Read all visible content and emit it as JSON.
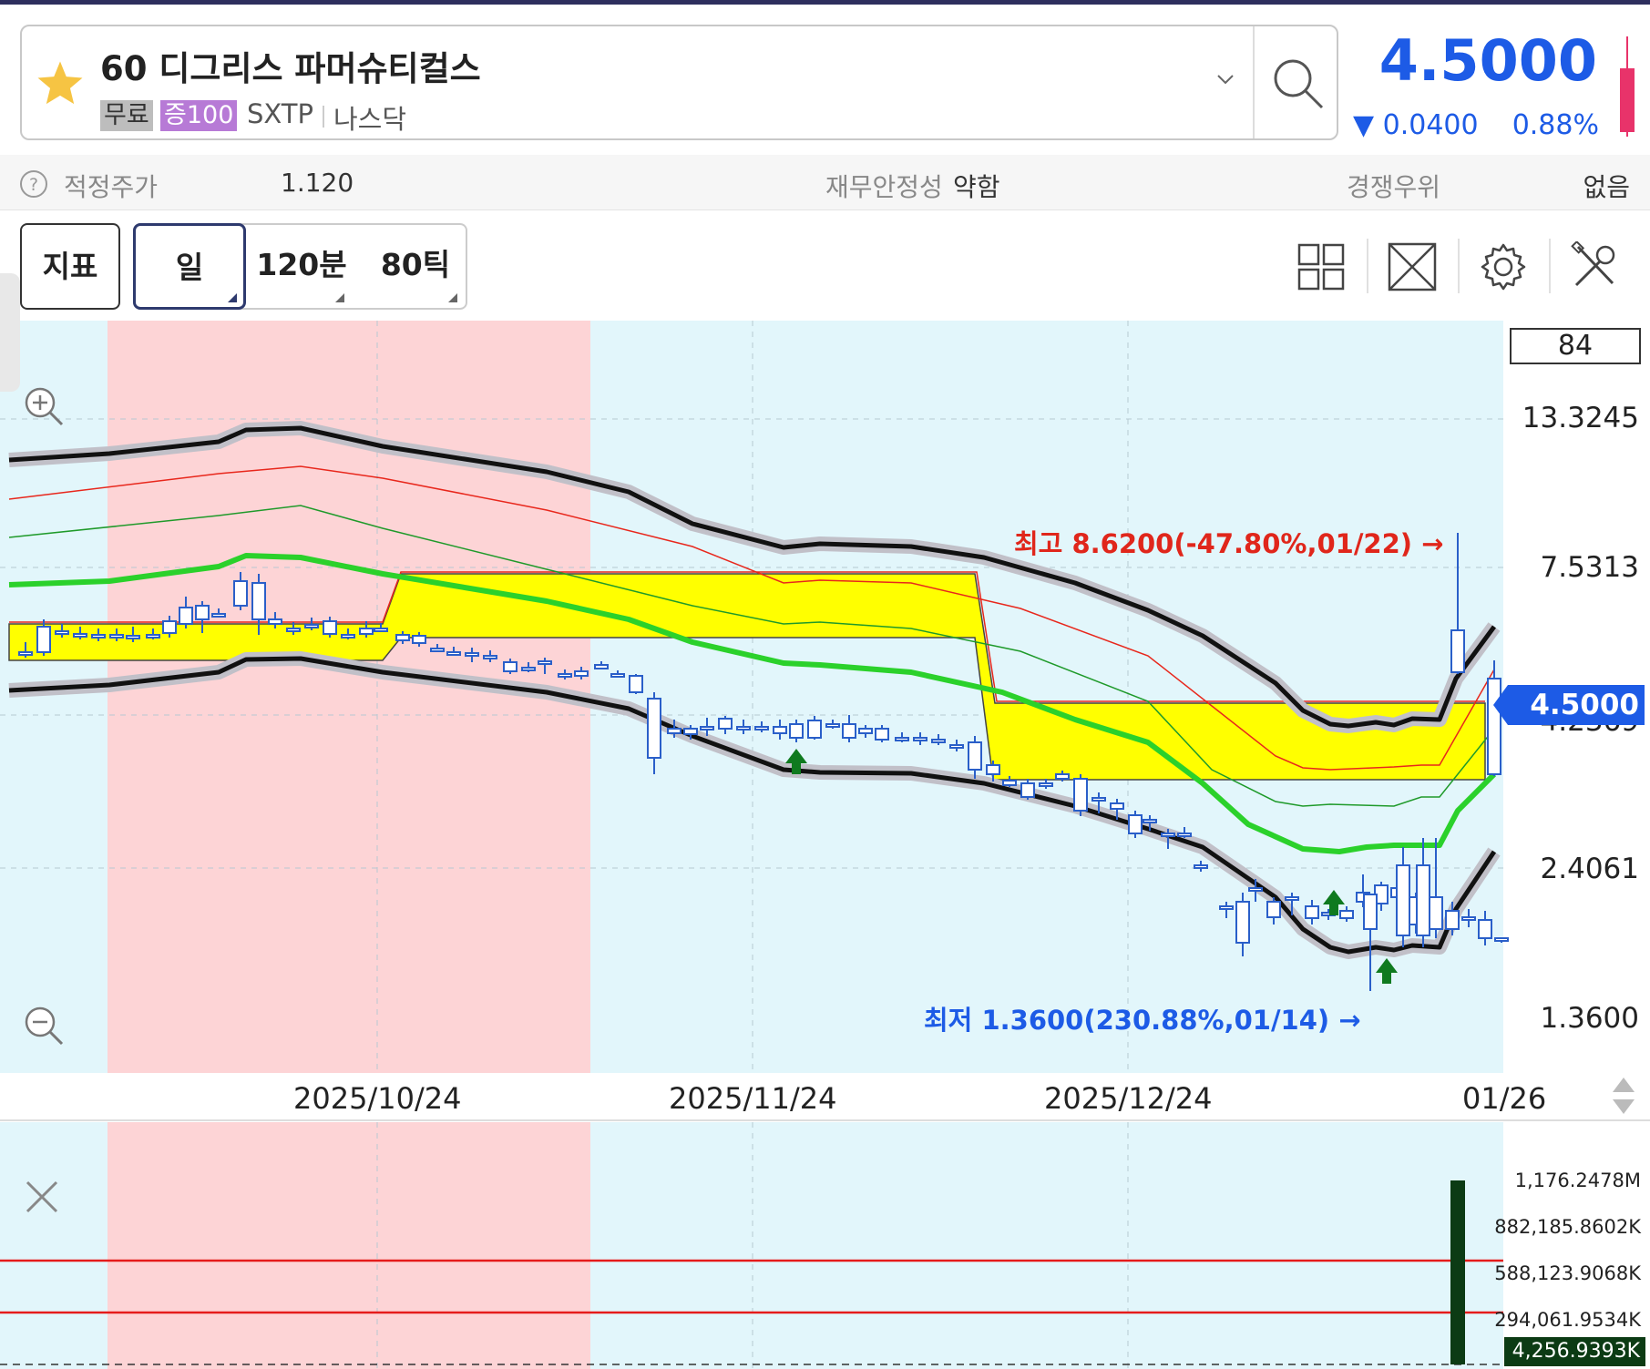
{
  "header": {
    "stock_name": "60 디그리스 파머슈티컬스",
    "tag_free": "무료",
    "tag_margin": "증100",
    "ticker": "SXTP",
    "exchange": "나스닥",
    "price": "4.5000",
    "change": "▼ 0.0400",
    "change_pct": "0.88%",
    "price_color": "#1d5be6"
  },
  "info": {
    "fair_price_label": "적정주가",
    "fair_price_value": "1.120",
    "stability_label": "재무안정성",
    "stability_value": "약함",
    "competitive_label": "경쟁우위",
    "competitive_value": "없음"
  },
  "toolbar": {
    "indicator_label": "지표",
    "period_day": "일",
    "period_120": "120분",
    "period_80": "80틱",
    "icons": [
      "layout-grid-icon",
      "fullscreen-icon",
      "settings-gear-icon",
      "tools-icon"
    ]
  },
  "chart": {
    "count_box": "84",
    "y_labels": [
      "13.3245",
      "7.5313",
      "4.2369",
      "2.4061",
      "1.3600"
    ],
    "current_price_marker": "4.5000",
    "x_labels": [
      "2025/10/24",
      "2025/11/24",
      "2025/12/24",
      "01/26"
    ],
    "high_annotation": "최고 8.6200(-47.80%,01/22) →",
    "low_annotation": "최저 1.3600(230.88%,01/14) →",
    "colors": {
      "up": "#e8271c",
      "down": "#2a5fc9",
      "band_fill": "#ffff00",
      "highlight": "#fdd4d6",
      "bg": "#e2f6fb"
    }
  },
  "chart_data": {
    "type": "candlestick",
    "y_scale": "log",
    "annotations": [
      {
        "label": "최고",
        "value": 8.62,
        "pct": "-47.80%",
        "date": "01/22"
      },
      {
        "label": "최저",
        "value": 1.36,
        "pct": "230.88%",
        "date": "01/14"
      }
    ],
    "last_price": 4.5,
    "count": 84
  },
  "volume": {
    "labels": [
      "1,176.2478M",
      "882,185.8602K",
      "588,123.9068K",
      "294,061.9534K"
    ],
    "current_marker": "4,256.9393K",
    "last_bar_value": "1,176.2478M"
  }
}
